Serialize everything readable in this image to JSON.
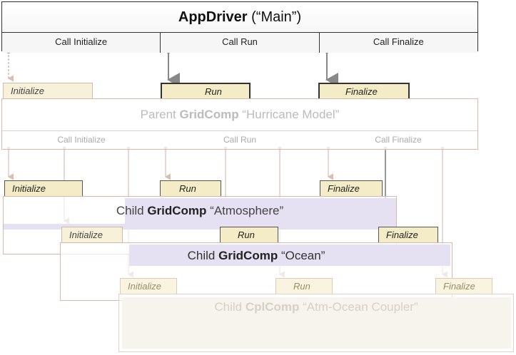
{
  "driver": {
    "title_bold": "AppDriver",
    "title_rest": " (“Main”)",
    "calls": [
      "Call Initialize",
      "Call Run",
      "Call Finalize"
    ]
  },
  "tab_labels": {
    "initialize": "Initialize",
    "run": "Run",
    "finalize": "Finalize"
  },
  "parent": {
    "title_pre": "Parent ",
    "title_bold": "GridComp",
    "title_rest": " “Hurricane Model”",
    "calls": [
      "Call Initialize",
      "Call Run",
      "Call Finalize"
    ]
  },
  "atmosphere": {
    "title_pre": "Child ",
    "title_bold": "GridComp",
    "title_rest": " “Atmosphere”"
  },
  "ocean": {
    "title_pre": "Child ",
    "title_bold": "GridComp",
    "title_rest": " “Ocean”"
  },
  "coupler": {
    "title_pre": "Child ",
    "title_bold": "CplComp",
    "title_rest": " “Atm-Ocean Coupler”"
  },
  "colors": {
    "tab_fill": "#f3ecc6",
    "band": "#e6e0f3",
    "connector": "#888888",
    "faded_border": "#d9b8a8"
  }
}
